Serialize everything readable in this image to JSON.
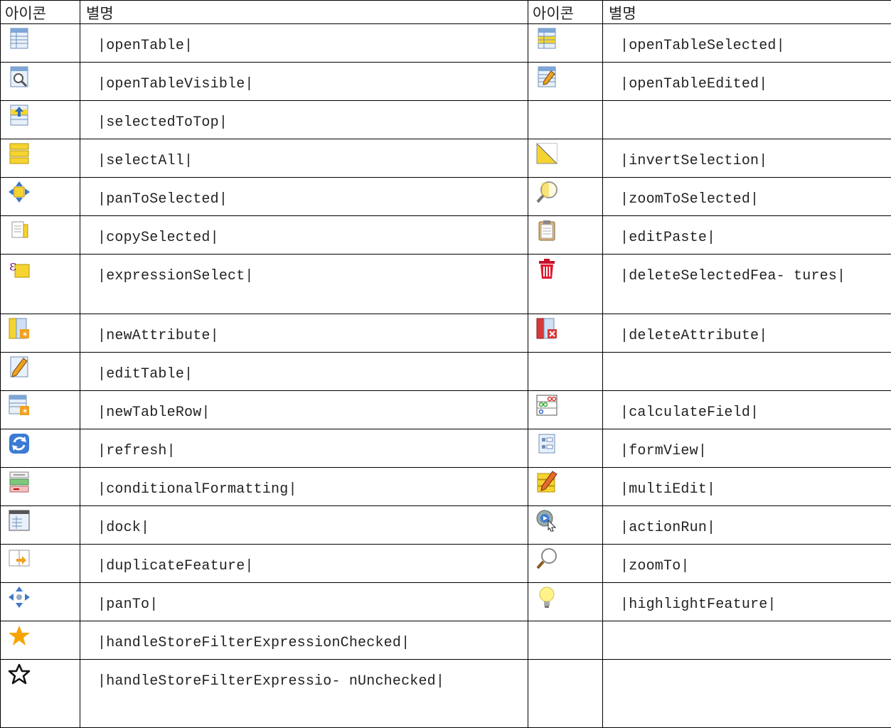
{
  "header": {
    "icon": "아이콘",
    "alias": "별명",
    "icon2": "아이콘",
    "alias2": "별명"
  },
  "rows": [
    {
      "left": {
        "icon": "open-table-icon",
        "alias": "|openTable|"
      },
      "right": {
        "icon": "open-table-selected-icon",
        "alias": "|openTableSelected|"
      }
    },
    {
      "left": {
        "icon": "open-table-visible-icon",
        "alias": "|openTableVisible|"
      },
      "right": {
        "icon": "open-table-edited-icon",
        "alias": "|openTableEdited|"
      }
    },
    {
      "left": {
        "icon": "selected-to-top-icon",
        "alias": "|selectedToTop|"
      },
      "right": {
        "icon": "",
        "alias": ""
      }
    },
    {
      "left": {
        "icon": "select-all-icon",
        "alias": "|selectAll|"
      },
      "right": {
        "icon": "invert-selection-icon",
        "alias": "|invertSelection|"
      }
    },
    {
      "left": {
        "icon": "pan-to-selected-icon",
        "alias": "|panToSelected|"
      },
      "right": {
        "icon": "zoom-to-selected-icon",
        "alias": "|zoomToSelected|"
      }
    },
    {
      "left": {
        "icon": "copy-selected-icon",
        "alias": "|copySelected|"
      },
      "right": {
        "icon": "edit-paste-icon",
        "alias": "|editPaste|"
      }
    },
    {
      "left": {
        "icon": "expression-select-icon",
        "alias": "|expressionSelect|"
      },
      "right": {
        "icon": "delete-selected-features-icon",
        "alias": "|deleteSelectedFea- tures|"
      }
    },
    {
      "left": {
        "icon": "new-attribute-icon",
        "alias": "|newAttribute|"
      },
      "right": {
        "icon": "delete-attribute-icon",
        "alias": "|deleteAttribute|"
      }
    },
    {
      "left": {
        "icon": "edit-table-icon",
        "alias": "|editTable|"
      },
      "right": {
        "icon": "",
        "alias": ""
      }
    },
    {
      "left": {
        "icon": "new-table-row-icon",
        "alias": "|newTableRow|"
      },
      "right": {
        "icon": "calculate-field-icon",
        "alias": "|calculateField|"
      }
    },
    {
      "left": {
        "icon": "refresh-icon",
        "alias": "|refresh|"
      },
      "right": {
        "icon": "form-view-icon",
        "alias": "|formView|"
      }
    },
    {
      "left": {
        "icon": "conditional-formatting-icon",
        "alias": "|conditionalFormatting|"
      },
      "right": {
        "icon": "multi-edit-icon",
        "alias": "|multiEdit|"
      }
    },
    {
      "left": {
        "icon": "dock-icon",
        "alias": "|dock|"
      },
      "right": {
        "icon": "action-run-icon",
        "alias": "|actionRun|"
      }
    },
    {
      "left": {
        "icon": "duplicate-feature-icon",
        "alias": "|duplicateFeature|"
      },
      "right": {
        "icon": "zoom-to-icon",
        "alias": "|zoomTo|"
      }
    },
    {
      "left": {
        "icon": "pan-to-icon",
        "alias": "|panTo|"
      },
      "right": {
        "icon": "highlight-feature-icon",
        "alias": "|highlightFeature|"
      }
    },
    {
      "left": {
        "icon": "star-filled-icon",
        "alias": "|handleStoreFilterExpressionChecked|"
      },
      "right": {
        "icon": "",
        "alias": ""
      }
    },
    {
      "left": {
        "icon": "star-outline-icon",
        "alias": "|handleStoreFilterExpressio- nUnchecked|"
      },
      "right": {
        "icon": "",
        "alias": ""
      }
    }
  ]
}
